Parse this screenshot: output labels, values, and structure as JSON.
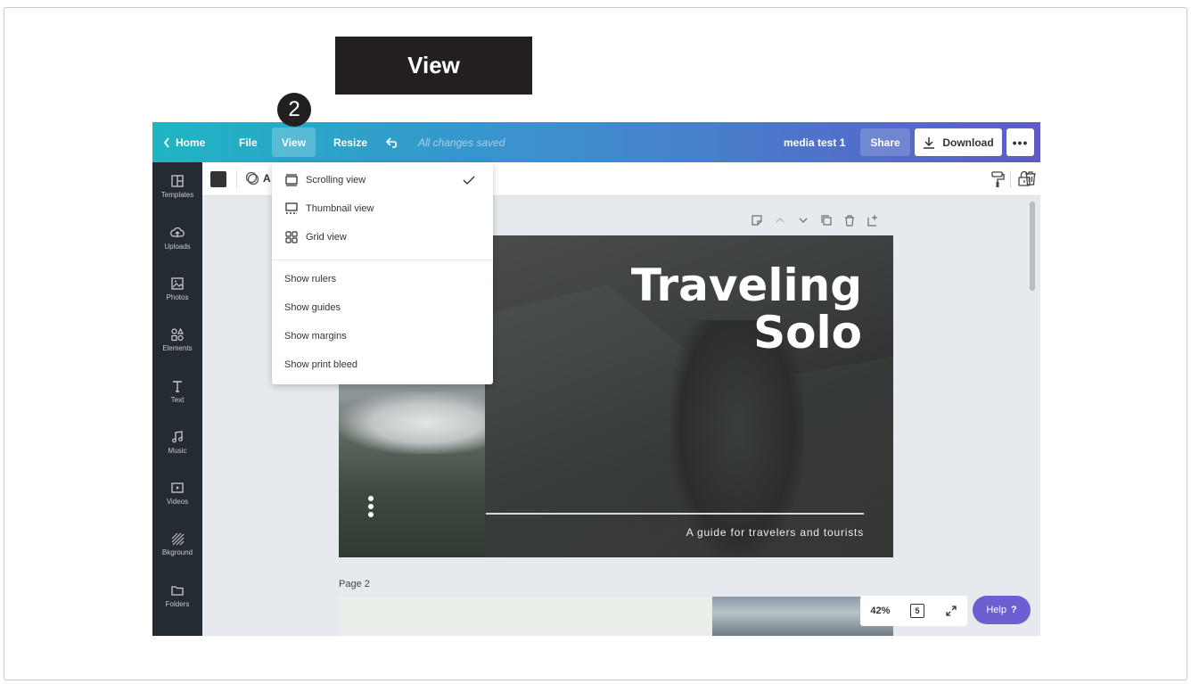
{
  "callout": {
    "label": "View",
    "step": "2"
  },
  "topbar": {
    "home": "Home",
    "file": "File",
    "view": "View",
    "resize": "Resize",
    "saved_status": "All changes saved",
    "doc_name": "media test 1",
    "share": "Share",
    "download": "Download",
    "more": "•••"
  },
  "sidebar": {
    "items": [
      {
        "label": "Templates",
        "icon": "templates-icon"
      },
      {
        "label": "Uploads",
        "icon": "uploads-icon"
      },
      {
        "label": "Photos",
        "icon": "photos-icon"
      },
      {
        "label": "Elements",
        "icon": "elements-icon"
      },
      {
        "label": "Text",
        "icon": "text-icon"
      },
      {
        "label": "Music",
        "icon": "music-icon"
      },
      {
        "label": "Videos",
        "icon": "videos-icon"
      },
      {
        "label": "Bkground",
        "icon": "background-icon"
      },
      {
        "label": "Folders",
        "icon": "folders-icon"
      }
    ]
  },
  "toolbar": {
    "letter": "A"
  },
  "view_menu": {
    "items": [
      {
        "label": "Scrolling view",
        "icon": "scrolling-view-icon",
        "checked": true
      },
      {
        "label": "Thumbnail view",
        "icon": "thumbnail-view-icon",
        "checked": false
      },
      {
        "label": "Grid view",
        "icon": "grid-view-icon",
        "checked": false
      }
    ],
    "options": [
      "Show rulers",
      "Show guides",
      "Show margins",
      "Show print bleed"
    ]
  },
  "design": {
    "title_line1": "Traveling",
    "title_line2": "Solo",
    "tagline": "A guide for travelers and tourists"
  },
  "page2_label": "Page 2",
  "zoom": "42%",
  "page_count": "5",
  "help": {
    "label": "Help",
    "icon": "?"
  },
  "colors": {
    "accent": "#6c5fd1",
    "sidebar": "#252b33",
    "callout": "#231f20"
  }
}
